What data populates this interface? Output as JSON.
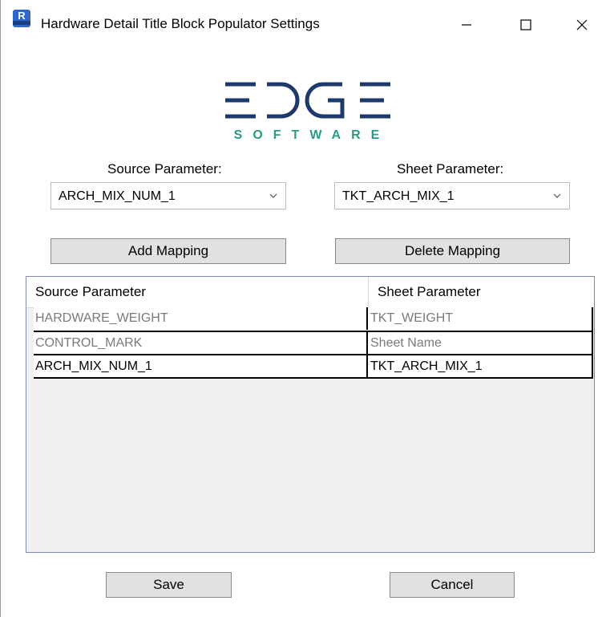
{
  "window": {
    "title": "Hardware Detail Title Block Populator Settings",
    "app_icon": {
      "letter": "R",
      "name": "revit-app-icon",
      "color": "#2f67c9"
    },
    "controls": {
      "minimize": "minimize-icon",
      "maximize": "maximize-icon",
      "close": "close-icon"
    }
  },
  "logo": {
    "wordmark": "EDGE",
    "subtitle": "SOFTWARE",
    "color": "#1e3a6b",
    "accent": "#2a9b83"
  },
  "source": {
    "label": "Source Parameter:",
    "selected": "ARCH_MIX_NUM_1"
  },
  "sheet": {
    "label": "Sheet Parameter:",
    "selected": "TKT_ARCH_MIX_1"
  },
  "actions": {
    "add_mapping": "Add Mapping",
    "delete_mapping": "Delete Mapping",
    "save": "Save",
    "cancel": "Cancel"
  },
  "grid": {
    "columns": [
      "Source Parameter",
      "Sheet Parameter"
    ],
    "rows": [
      {
        "source": "HARDWARE_WEIGHT",
        "sheet": "TKT_WEIGHT"
      },
      {
        "source": "CONTROL_MARK",
        "sheet": "Sheet Name"
      },
      {
        "source": "ARCH_MIX_NUM_1",
        "sheet": "TKT_ARCH_MIX_1"
      }
    ]
  }
}
